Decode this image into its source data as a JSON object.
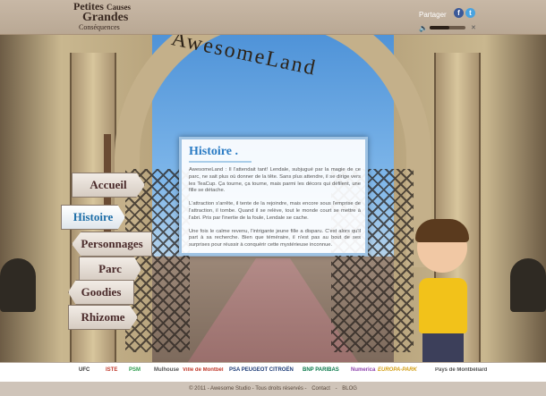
{
  "header": {
    "logo_line1": "Petites",
    "logo_line2": "Causes",
    "logo_line3": "Grandes",
    "logo_line4": "Conséquences",
    "share_label": "Partager",
    "facebook_glyph": "f",
    "twitter_glyph": "t",
    "volume_fraction": 0.55
  },
  "scene": {
    "arch_text": "AwesomeLand"
  },
  "nav": {
    "items": [
      {
        "label": "Accueil",
        "active": false
      },
      {
        "label": "Histoire",
        "active": true
      },
      {
        "label": "Personnages",
        "active": false
      },
      {
        "label": "Parc",
        "active": false
      },
      {
        "label": "Goodies",
        "active": false
      },
      {
        "label": "Rhizome",
        "active": false
      }
    ]
  },
  "panel": {
    "title": "Histoire .",
    "paragraphs": [
      "AwesomeLand : Il l'attendait tant! Lendale, subjugué par la magie de ce parc, ne sait plus où donner de la tête. Sans plus attendre, il se dirige vers les TeaCup. Ça tourne, ça tourne, mais parmi les décors qui défilent, une fille se détache.",
      "L'attraction s'arrête, il tente de la rejoindre, mais encore sous l'emprise de l'attraction, il tombe. Quand il se relève, tout le monde court se mettre à l'abri. Pris par l'inertie de la foule, Lendale se cache.",
      "Une fois le calme revenu, l'intrigante jeune fille a disparu. C'est alors qu'il part à sa recherche. Bien que téméraire, il n'est pas au bout de ses surprises pour réussir à conquérir cette mystérieuse inconnue."
    ]
  },
  "sponsors": [
    {
      "label": "UFC",
      "color": "#333333"
    },
    {
      "label": "ISTE",
      "color": "#c0392b"
    },
    {
      "label": "PSM",
      "color": "#2e9d4e"
    },
    {
      "label": "Mulhouse",
      "color": "#555555"
    },
    {
      "label": "Ville de Montbéliard",
      "color": "#c0392b"
    },
    {
      "label": "PSA PEUGEOT CITROËN",
      "color": "#1d3c78"
    },
    {
      "label": "BNP PARIBAS",
      "color": "#0b7a4b"
    },
    {
      "label": "Numerica",
      "color": "#8e44ad"
    },
    {
      "label": "EUROPA-PARK",
      "color": "#d4a017"
    },
    {
      "label": "Pays de Montbéliard",
      "color": "#555555"
    }
  ],
  "footer": {
    "copyright": "© 2011 - Awesome Studio - Tous droits réservés -",
    "contact": "Contact",
    "separator": "-",
    "blog": "BLOG"
  }
}
